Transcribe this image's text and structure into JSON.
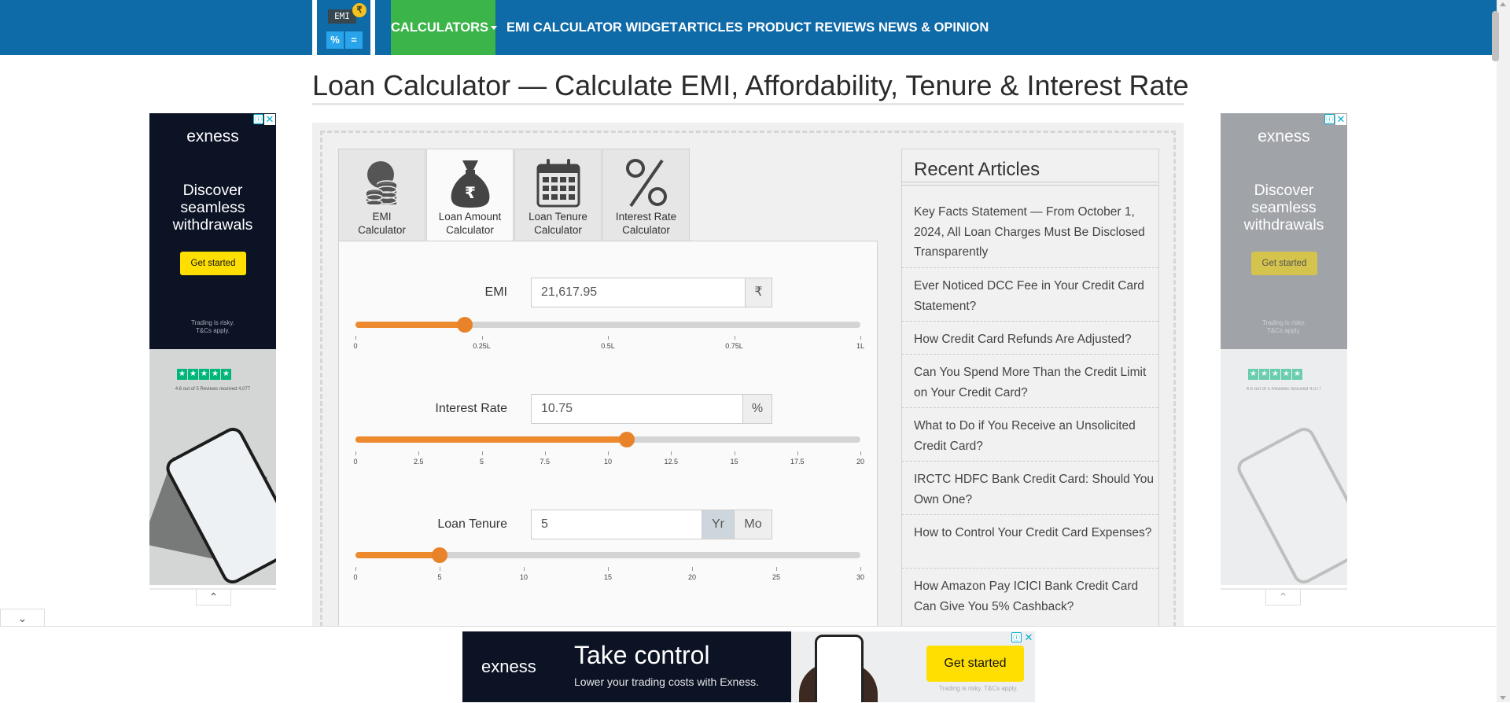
{
  "nav": {
    "logo": {
      "screen_text": "EMI",
      "coin": "₹",
      "key1": "%",
      "key2": "="
    },
    "items": [
      {
        "label": "CALCULATORS",
        "has_dropdown": true,
        "active": true
      },
      {
        "label": "EMI CALCULATOR WIDGET"
      },
      {
        "label": "ARTICLES"
      },
      {
        "label": "PRODUCT REVIEWS"
      },
      {
        "label": "NEWS & OPINION"
      }
    ]
  },
  "page": {
    "title": "Loan Calculator — Calculate EMI, Affordability, Tenure & Interest Rate"
  },
  "tabs": [
    {
      "label_line1": "EMI",
      "label_line2": "Calculator",
      "icon": "coin-stack-icon",
      "active": false
    },
    {
      "label_line1": "Loan Amount",
      "label_line2": "Calculator",
      "icon": "money-bag-icon",
      "active": true
    },
    {
      "label_line1": "Loan Tenure",
      "label_line2": "Calculator",
      "icon": "calendar-icon",
      "active": false
    },
    {
      "label_line1": "Interest Rate",
      "label_line2": "Calculator",
      "icon": "percent-icon",
      "active": false
    }
  ],
  "calculator": {
    "emi": {
      "label": "EMI",
      "value": "21,617.95",
      "unit": "₹",
      "slider": {
        "min": 0,
        "max": 100000,
        "value": 21617.95,
        "ticks": [
          "0",
          "0.25L",
          "0.5L",
          "0.75L",
          "1L"
        ]
      }
    },
    "interest": {
      "label": "Interest Rate",
      "value": "10.75",
      "unit": "%",
      "slider": {
        "min": 0,
        "max": 20,
        "value": 10.75,
        "ticks": [
          "0",
          "2.5",
          "5",
          "7.5",
          "10",
          "12.5",
          "15",
          "17.5",
          "20"
        ]
      }
    },
    "tenure": {
      "label": "Loan Tenure",
      "value": "5",
      "unit_year": "Yr",
      "unit_month": "Mo",
      "selected_unit": "Yr",
      "slider": {
        "min": 0,
        "max": 30,
        "value": 5,
        "ticks": [
          "0",
          "5",
          "10",
          "15",
          "20",
          "25",
          "30"
        ]
      }
    }
  },
  "sidebar": {
    "title": "Recent Articles",
    "articles": [
      "Key Facts Statement — From October 1, 2024, All Loan Charges Must Be Disclosed Transparently",
      "Ever Noticed DCC Fee in Your Credit Card Statement?",
      "How Credit Card Refunds Are Adjusted?",
      "Can You Spend More Than the Credit Limit on Your Credit Card?",
      "What to Do if You Receive an Unsolicited Credit Card?",
      "IRCTC HDFC Bank Credit Card: Should You Own One?",
      "How to Control Your Credit Card Expenses?",
      "How Amazon Pay ICICI Bank Credit Card Can Give You 5% Cashback?"
    ]
  },
  "ads": {
    "side": {
      "brand": "exness",
      "headline": "Discover seamless withdrawals",
      "cta": "Get started",
      "disclaimer_line1": "Trading is risky.",
      "disclaimer_line2": "T&Cs apply.",
      "review_text": "4.6 out of 5 Reviews received 4,077",
      "info_icon": "ⓘ",
      "close_icon": "✕"
    },
    "bottom": {
      "brand": "exness",
      "headline": "Take control",
      "subline": "Lower your trading costs with Exness.",
      "cta": "Get started",
      "disclaimer": "Trading is risky. T&Cs apply.",
      "info_icon": "ⓘ",
      "close_icon": "✕"
    },
    "collapse_up_icon": "⌃",
    "collapse_down_icon": "⌄"
  },
  "colors": {
    "nav_bg": "#0f6aa8",
    "nav_active": "#3bb44a",
    "slider_fill": "#ee8a2e",
    "slider_track": "#d4d4d4",
    "ad_dark": "#0b1325",
    "ad_cta": "#ffde02"
  }
}
